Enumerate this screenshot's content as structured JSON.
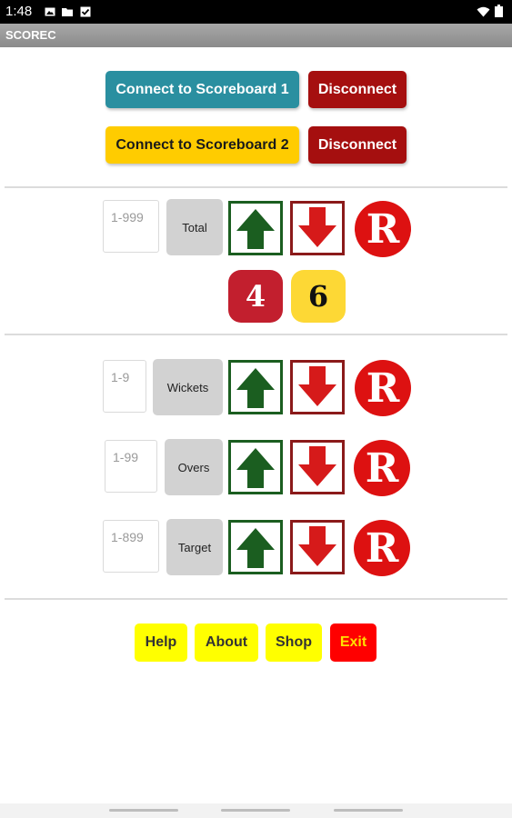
{
  "status_bar": {
    "time": "1:48"
  },
  "app": {
    "title": "SCOREC"
  },
  "connections": [
    {
      "connect_label": "Connect to Scoreboard 1",
      "disconnect_label": "Disconnect",
      "color": "#2a8fa0"
    },
    {
      "connect_label": "Connect to Scoreboard 2",
      "disconnect_label": "Disconnect",
      "color": "#ffcc00"
    }
  ],
  "total": {
    "placeholder": "1-999",
    "label": "Total",
    "reset_label": "R",
    "score_digits": [
      "4",
      "6"
    ]
  },
  "rows": [
    {
      "placeholder": "1-9",
      "label": "Wickets",
      "reset_label": "R"
    },
    {
      "placeholder": "1-99",
      "label": "Overs",
      "reset_label": "R"
    },
    {
      "placeholder": "1-899",
      "label": "Target",
      "reset_label": "R"
    }
  ],
  "bottom": {
    "help_label": "Help",
    "about_label": "About",
    "shop_label": "Shop",
    "exit_label": "Exit"
  },
  "colors": {
    "disconnect": "#a50f0f",
    "arrow_up": "#1b5e20",
    "arrow_down": "#d61a1a",
    "reset": "#dd1111",
    "score_red": "#c21f2e",
    "score_yellow": "#fdd835",
    "bottom_yellow": "#ffff00",
    "exit_red": "#ff0000"
  },
  "icons": [
    "wifi-icon",
    "battery-icon",
    "image-icon",
    "folder-icon",
    "checkbox-icon",
    "arrow-up-icon",
    "arrow-down-icon"
  ]
}
